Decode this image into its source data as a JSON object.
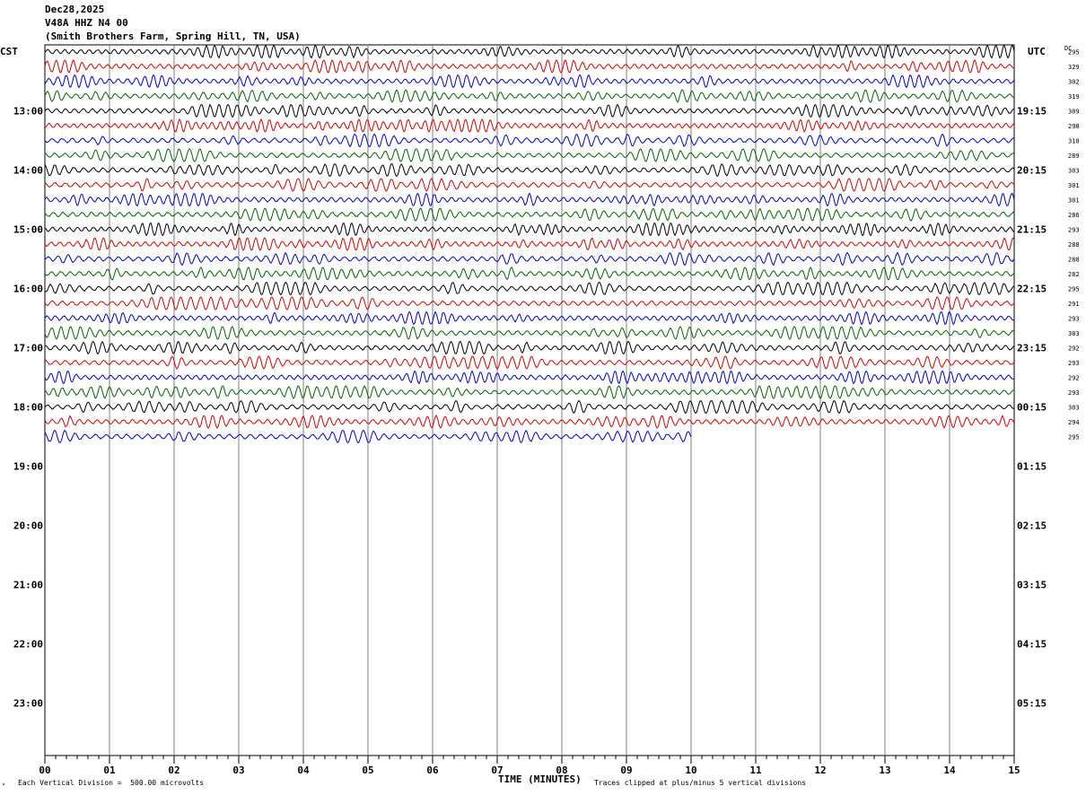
{
  "header": {
    "date": "Dec28,2025",
    "station": "V48A HHZ N4 00",
    "location": "(Smith Brothers Farm, Spring Hill, TN, USA)"
  },
  "axes": {
    "left_label": "CST",
    "right_label": "UTC",
    "dc_label": "DC",
    "xlabel": "TIME (MINUTES)",
    "scale_note": "Each Vertical Division =  500.00 microvolts",
    "clip_note": "Traces clipped at plus/minus 5 vertical divisions",
    "corner_mark": "ᴿ"
  },
  "colors": {
    "trace_cycle": [
      "#000000",
      "#d40000",
      "#0000c8",
      "#006400"
    ],
    "grid": "#7f7f7f"
  },
  "chart_data": {
    "type": "line",
    "title": "",
    "x_ticks": [
      "00",
      "01",
      "02",
      "03",
      "04",
      "05",
      "06",
      "07",
      "08",
      "09",
      "10",
      "11",
      "12",
      "13",
      "14",
      "15"
    ],
    "xlim": [
      0,
      15
    ],
    "rows_total": 48,
    "traces_per_hour": 4,
    "minutes_per_trace": 15,
    "left_hour_labels": [
      "13:00",
      "14:00",
      "15:00",
      "16:00",
      "17:00",
      "18:00",
      "19:00",
      "20:00",
      "21:00",
      "22:00",
      "23:00"
    ],
    "right_hour_labels": [
      "19:15",
      "20:15",
      "21:15",
      "22:15",
      "23:15",
      "00:15",
      "01:15",
      "02:15",
      "03:15",
      "04:15",
      "05:15"
    ],
    "dc_offsets": [
      295,
      329,
      302,
      319,
      309,
      298,
      310,
      289,
      303,
      301,
      301,
      286,
      293,
      288,
      288,
      282,
      295,
      291,
      293,
      303,
      292,
      293,
      292,
      293,
      303,
      294,
      295
    ],
    "last_trace_end_minute": 10,
    "grid": true
  }
}
